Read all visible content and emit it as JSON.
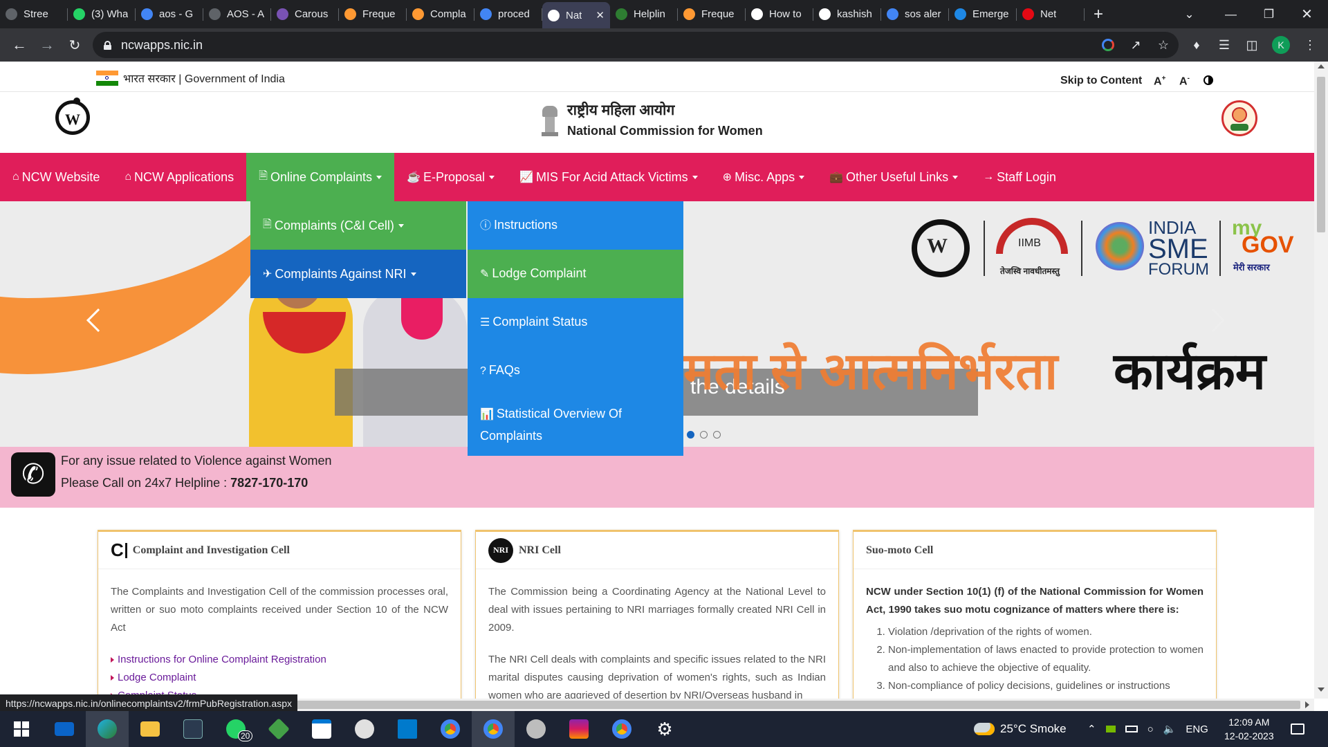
{
  "browser": {
    "tabs": [
      {
        "title": "Stree",
        "favicon": "globe-icon",
        "color": "#5f6368"
      },
      {
        "title": "(3) Wha",
        "favicon": "whatsapp-icon",
        "color": "#25d366"
      },
      {
        "title": "aos - G",
        "favicon": "google-icon",
        "color": "#4285f4"
      },
      {
        "title": "AOS - A",
        "favicon": "globe-icon",
        "color": "#5f6368"
      },
      {
        "title": "Carous",
        "favicon": "bootstrap-icon",
        "color": "#7952b3"
      },
      {
        "title": "Freque",
        "favicon": "india-flag-icon",
        "color": "#ff9933"
      },
      {
        "title": "Compla",
        "favicon": "india-flag-icon",
        "color": "#ff9933"
      },
      {
        "title": "proced",
        "favicon": "google-icon",
        "color": "#4285f4"
      },
      {
        "title": "Nat",
        "favicon": "ncw-icon",
        "color": "#ffffff",
        "active": true
      },
      {
        "title": "Helplin",
        "favicon": "check-icon",
        "color": "#2e7d32"
      },
      {
        "title": "Freque",
        "favicon": "india-flag-icon",
        "color": "#ff9933"
      },
      {
        "title": "How to",
        "favicon": "wikihow-icon",
        "color": "#ffffff"
      },
      {
        "title": "kashish",
        "favicon": "github-icon",
        "color": "#ffffff"
      },
      {
        "title": "sos aler",
        "favicon": "google-icon",
        "color": "#4285f4"
      },
      {
        "title": "Emerge",
        "favicon": "gif-icon",
        "color": "#1e88e5"
      },
      {
        "title": "Net",
        "favicon": "netflix-icon",
        "color": "#e50914"
      }
    ],
    "url": "ncwapps.nic.in",
    "profile_initial": "K",
    "status_url": "https://ncwapps.nic.in/onlinecomplaintsv2/frmPubRegistration.aspx"
  },
  "gov_strip": {
    "label": "भारत सरकार | Government of India",
    "skip": "Skip to Content",
    "font_plus": "A",
    "font_minus": "A"
  },
  "header": {
    "title_hi": "राष्ट्रीय महिला आयोग",
    "title_en": "National Commission for Women"
  },
  "nav": {
    "items": [
      {
        "label": "NCW Website",
        "icon": "home-icon"
      },
      {
        "label": "NCW Applications",
        "icon": "home-icon"
      },
      {
        "label": "Online Complaints",
        "icon": "file-icon",
        "dropdown": true
      },
      {
        "label": "E-Proposal",
        "icon": "coffee-icon",
        "dropdown": true
      },
      {
        "label": "MIS For Acid Attack Victims",
        "icon": "chart-line-icon",
        "dropdown": true
      },
      {
        "label": "Misc. Apps",
        "icon": "plus-circle-icon",
        "dropdown": true
      },
      {
        "label": "Other Useful Links",
        "icon": "briefcase-icon",
        "dropdown": true
      },
      {
        "label": "Staff Login",
        "icon": "sign-in-icon"
      }
    ],
    "submenu": [
      {
        "label": "Complaints (C&I Cell)",
        "icon": "file-icon"
      },
      {
        "label": "Complaints Against NRI",
        "icon": "plane-icon"
      }
    ],
    "nri_menu": [
      {
        "label": "Instructions",
        "icon": "info-circle-icon"
      },
      {
        "label": "Lodge Complaint",
        "icon": "edit-icon"
      },
      {
        "label": "Complaint Status",
        "icon": "list-icon"
      },
      {
        "label": "FAQs",
        "icon": "question-circle-icon"
      },
      {
        "label": "Statistical Overview Of Complaints",
        "icon": "bar-chart-icon"
      }
    ]
  },
  "hero": {
    "caption": "the details",
    "banner_hi_left": "मता से आत्मनिर्भरता",
    "banner_hi_right": "कार्यक्रम",
    "logos": [
      "IIMB",
      "तेजस्वि नावधीतमस्तु",
      "INDIA",
      "SME",
      "FORUM",
      "my",
      "GOV",
      "मेरी सरकार"
    ]
  },
  "helpline": {
    "line1": "For any issue related to Violence against Women",
    "line2": "Please Call on 24x7 Helpline :",
    "number": "7827-170-170"
  },
  "cards": [
    {
      "title": "Complaint and Investigation Cell",
      "badge": "C",
      "body": "The Complaints and Investigation Cell of the commission processes oral, written or suo moto complaints received under Section 10 of the NCW Act",
      "links": [
        "Instructions for Online Complaint Registration",
        "Lodge Complaint",
        "Complaint Status"
      ]
    },
    {
      "title": "NRI Cell",
      "badge": "NRI",
      "body": "The Commission being a Coordinating Agency at the National Level to deal with issues pertaining to NRI marriages formally created NRI Cell in 2009.",
      "body2": "The NRI Cell deals with complaints and specific issues related to the NRI marital disputes causing deprivation of women's rights, such as Indian women who are aggrieved of desertion by NRI/Overseas husband in"
    },
    {
      "title": "Suo-moto Cell",
      "body": "NCW under Section 10(1) (f) of the National Commission for Women Act, 1990 takes suo motu cognizance of matters where there is:",
      "items": [
        "Violation /deprivation of the rights of women.",
        "Non-implementation of laws enacted to provide protection to women and also to achieve the objective of equality.",
        "Non-compliance of policy decisions, guidelines or instructions"
      ]
    }
  ],
  "taskbar": {
    "weather": "25°C Smoke",
    "lang": "ENG",
    "time": "12:09 AM",
    "date": "12-02-2023",
    "whatsapp_badge": "20"
  }
}
